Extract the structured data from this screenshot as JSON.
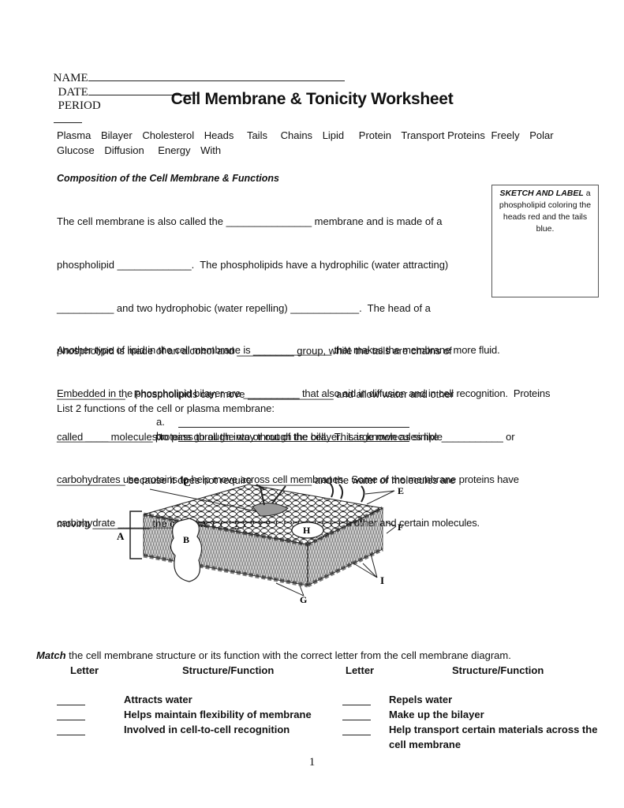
{
  "header": {
    "name_label": "NAME",
    "date_label": "DATE",
    "period_label": "PERIOD"
  },
  "title": "Cell Membrane & Tonicity Worksheet",
  "word_bank": [
    "Plasma",
    "Bilayer",
    "Cholesterol",
    "Heads",
    "Tails",
    "Chains",
    "Lipid",
    "Protein",
    "Transport Proteins",
    "Freely",
    "Polar",
    "Glucose",
    "Diffusion",
    "Energy",
    "With"
  ],
  "composition": {
    "heading": "Composition of the Cell Membrane & Functions",
    "lines": [
      "The cell membrane is also called the _______________ membrane and is made of a",
      "phospholipid _____________.  The phospholipids have a hydrophilic (water attracting)",
      "__________ and two hydrophobic (water repelling) ____________.  The head of a",
      "phospholipid is made of an alcohol and __________ group, while the tails are chains of",
      "____________.  Phospholipids can move _______________ and allow water and other",
      "_________ molecules to pass through into or out of the cell.  This is known as simple",
      "____________ because it does not require __________ and the water or molecules are",
      "moving __________ the concentration gradient."
    ]
  },
  "sketch_box": {
    "bold_label": "SKETCH AND LABEL",
    "instruction": " a phospholipid coloring the heads red and the tails blue."
  },
  "proteins_paragraph": {
    "lines": [
      "Another type of lipid in the cell membrane is ______________ that makes the membrane more fluid.",
      "Embedded in the phospholipid bilayer are __________ that also aid in diffusion and in cell recognition.  Proteins",
      "called ____________ proteins go all the way through the bilayer.  Large molecules like ___________ or",
      "carbohydrates use proteins to help move across cell membranes.  Some of the membrane proteins have",
      "carbohydrate __________ attached to help cells in recognize each other and certain molecules."
    ]
  },
  "functions_list": {
    "prompt": "List 2 functions of the cell or plasma membrane:",
    "items": [
      "a.",
      "b."
    ]
  },
  "diagram": {
    "labels": [
      "A",
      "B",
      "C",
      "E",
      "F",
      "G",
      "H",
      "I"
    ]
  },
  "matching": {
    "intro_bold": "Match",
    "intro_rest": " the cell membrane structure or its function with the correct letter from the cell membrane diagram.",
    "col_letter": "Letter",
    "col_structure": "Structure/Function",
    "left_items": [
      "Attracts water",
      "Helps maintain flexibility of membrane",
      "Involved in cell-to-cell recognition"
    ],
    "right_items": [
      "Repels water",
      "Make up the bilayer",
      "Help transport certain materials across the",
      "cell membrane"
    ]
  },
  "page_number": "1"
}
